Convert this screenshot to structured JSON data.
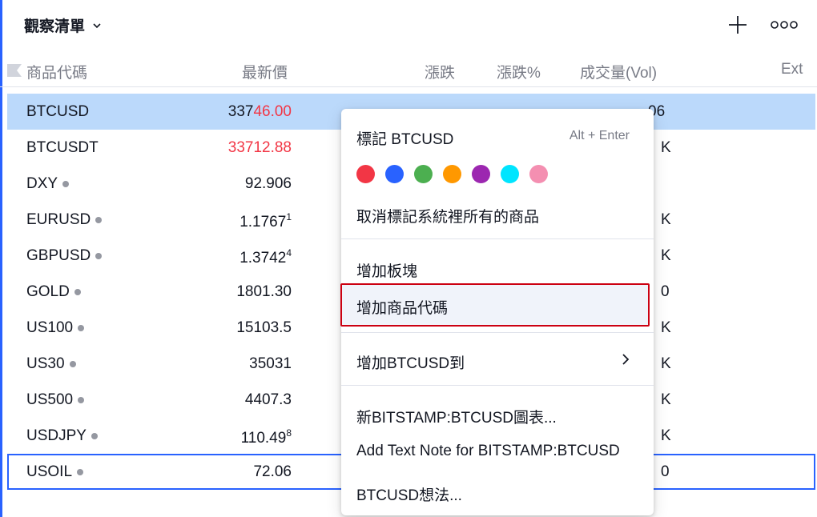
{
  "watchlist": {
    "title": "觀察清單"
  },
  "columns": {
    "symbol": "商品代碼",
    "last": "最新價",
    "chg": "漲跌",
    "chg_pct": "漲跌%",
    "vol": "成交量(Vol)",
    "ext": "Ext"
  },
  "rows": [
    {
      "symbol": "BTCUSD",
      "price_a": "337",
      "price_b": "46.00",
      "price_sup": "",
      "right": "06"
    },
    {
      "symbol": "BTCUSDT",
      "price_a": "",
      "price_b": "33712.88",
      "price_sup": "",
      "right": "K"
    },
    {
      "symbol": "DXY",
      "price_a": "92.906",
      "price_b": "",
      "price_sup": "",
      "right": ""
    },
    {
      "symbol": "EURUSD",
      "price_a": "1.1767",
      "price_b": "",
      "price_sup": "1",
      "right": "K"
    },
    {
      "symbol": "GBPUSD",
      "price_a": "1.3742",
      "price_b": "",
      "price_sup": "4",
      "right": "K"
    },
    {
      "symbol": "GOLD",
      "price_a": "1801.30",
      "price_b": "",
      "price_sup": "",
      "right": "0"
    },
    {
      "symbol": "US100",
      "price_a": "15103.5",
      "price_b": "",
      "price_sup": "",
      "right": "K"
    },
    {
      "symbol": "US30",
      "price_a": "35031",
      "price_b": "",
      "price_sup": "",
      "right": "K"
    },
    {
      "symbol": "US500",
      "price_a": "4407.3",
      "price_b": "",
      "price_sup": "",
      "right": "K"
    },
    {
      "symbol": "USDJPY",
      "price_a": "110.49",
      "price_b": "",
      "price_sup": "8",
      "right": "K"
    },
    {
      "symbol": "USOIL",
      "price_a": "72.06",
      "price_b": "",
      "price_sup": "",
      "right": "0"
    }
  ],
  "context_menu": {
    "flag_label": "標記 BTCUSD",
    "flag_shortcut": "Alt + Enter",
    "flag_colors": [
      "#f23645",
      "#2962ff",
      "#4caf50",
      "#ff9800",
      "#9c27b0",
      "#00e5ff",
      "#f48fb1"
    ],
    "unflag_all": "取消標記系統裡所有的商品",
    "add_section": "增加板塊",
    "add_symbol": "增加商品代碼",
    "add_to": "增加BTCUSD到",
    "new_chart": "新BITSTAMP:BTCUSD圖表...",
    "add_note": "Add Text Note for BITSTAMP:BTCUSD",
    "ideas": "BTCUSD想法..."
  },
  "colors": {
    "accent": "#2962ff",
    "selected_row": "#bbd9fb",
    "price_down": "#f23645",
    "highlight_border": "#cc0011"
  }
}
